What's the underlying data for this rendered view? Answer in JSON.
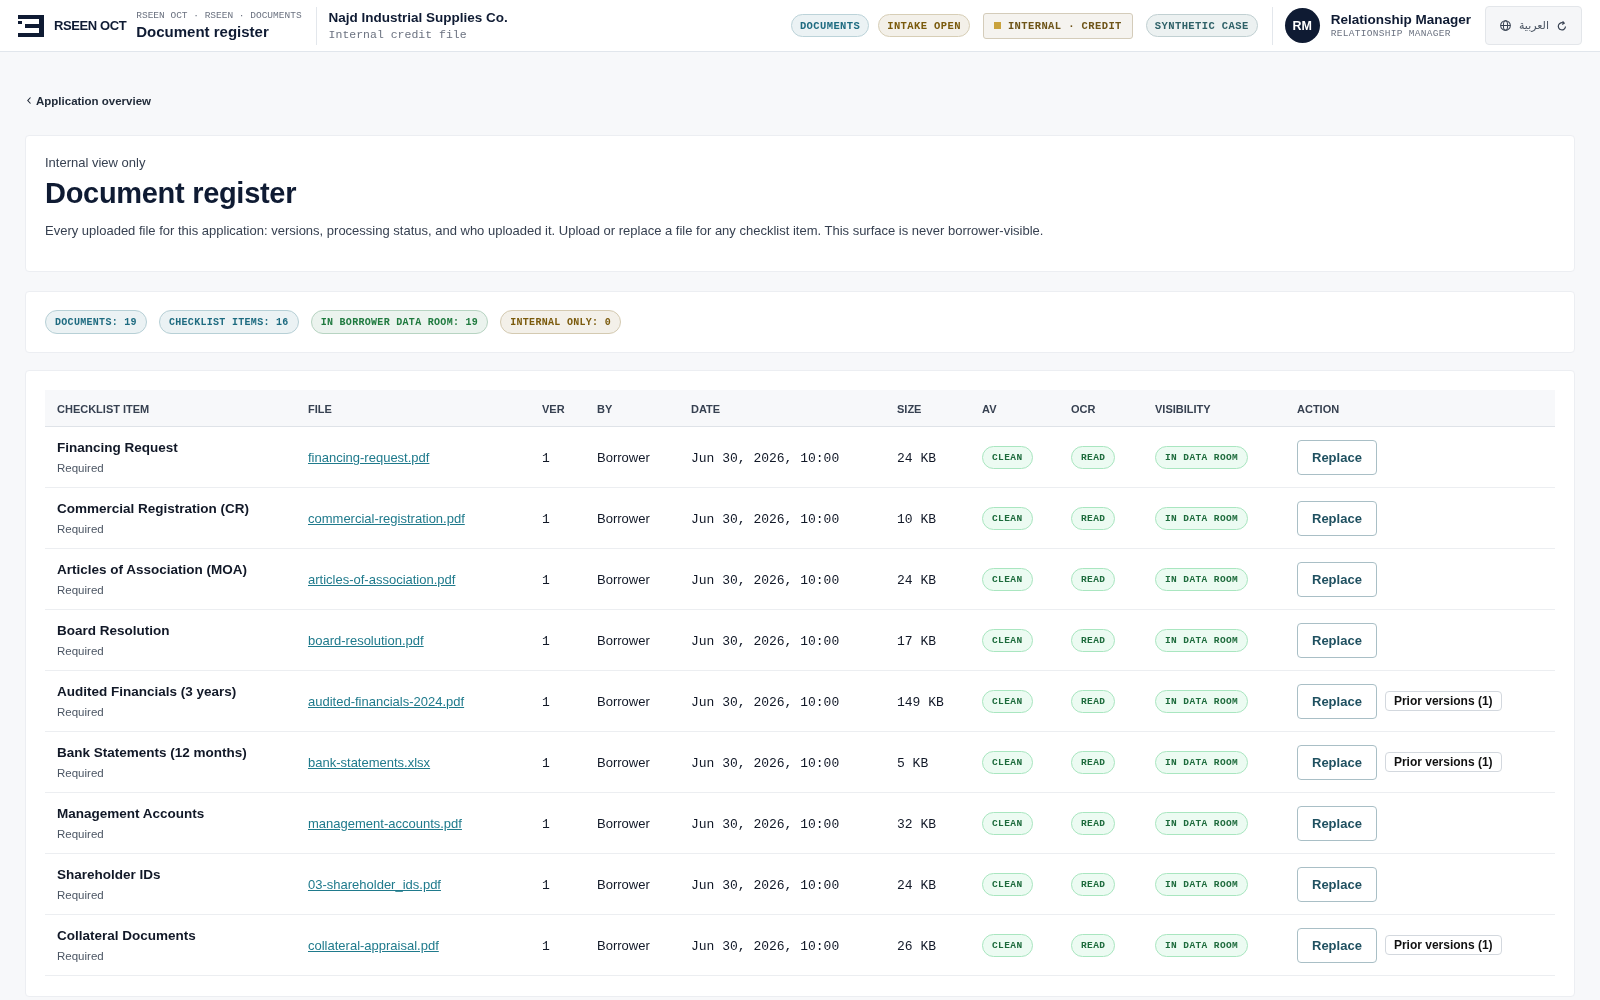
{
  "header": {
    "brand": "RSEEN OCT",
    "breadcrumb": "RSEEN OCT · RSEEN · DOCUMENTS",
    "title": "Document register",
    "company": "Najd Industrial Supplies Co.",
    "company_subtitle": "Internal credit file",
    "badges": [
      {
        "label": "DOCUMENTS",
        "kind": "pill",
        "color": "#1e6b80"
      },
      {
        "label": "INTAKE OPEN",
        "kind": "pill",
        "color": "#7a5a0c"
      },
      {
        "label": "INTERNAL · CREDIT",
        "kind": "flag",
        "color": "#6e5418"
      },
      {
        "label": "SYNTHETIC CASE",
        "kind": "pill",
        "color": "#2f6168"
      }
    ],
    "user": {
      "initials": "RM",
      "name": "Relationship Manager",
      "role": "RELATIONSHIP MANAGER"
    },
    "language_button": {
      "label": "العربية"
    }
  },
  "back_link": "Application overview",
  "intro": {
    "eyebrow": "Internal view only",
    "title": "Document register",
    "description": "Every uploaded file for this application: versions, processing status, and who uploaded it. Upload or replace a file for any checklist item. This surface is never borrower-visible."
  },
  "stats": [
    {
      "label": "DOCUMENTS: 19",
      "color": "#1e6b80"
    },
    {
      "label": "CHECKLIST ITEMS: 16",
      "color": "#1e6b80"
    },
    {
      "label": "IN BORROWER DATA ROOM: 19",
      "color": "#1f7a3f"
    },
    {
      "label": "INTERNAL ONLY: 0",
      "color": "#7a5a0c"
    }
  ],
  "table": {
    "columns": [
      "CHECKLIST ITEM",
      "FILE",
      "VER",
      "BY",
      "DATE",
      "SIZE",
      "AV",
      "OCR",
      "VISIBILITY",
      "ACTION"
    ],
    "rows": [
      {
        "item": "Financing Request",
        "requirement": "Required",
        "file": "financing-request.pdf",
        "version": "1",
        "uploaded_by": "Borrower",
        "date": "Jun 30, 2026, 10:00",
        "size": "24 KB",
        "av": "CLEAN",
        "ocr": "READ",
        "visibility": "IN DATA ROOM",
        "actions": [
          {
            "kind": "replace",
            "label": "Replace"
          }
        ]
      },
      {
        "item": "Commercial Registration (CR)",
        "requirement": "Required",
        "file": "commercial-registration.pdf",
        "version": "1",
        "uploaded_by": "Borrower",
        "date": "Jun 30, 2026, 10:00",
        "size": "10 KB",
        "av": "CLEAN",
        "ocr": "READ",
        "visibility": "IN DATA ROOM",
        "actions": [
          {
            "kind": "replace",
            "label": "Replace"
          }
        ]
      },
      {
        "item": "Articles of Association (MOA)",
        "requirement": "Required",
        "file": "articles-of-association.pdf",
        "version": "1",
        "uploaded_by": "Borrower",
        "date": "Jun 30, 2026, 10:00",
        "size": "24 KB",
        "av": "CLEAN",
        "ocr": "READ",
        "visibility": "IN DATA ROOM",
        "actions": [
          {
            "kind": "replace",
            "label": "Replace"
          }
        ]
      },
      {
        "item": "Board Resolution",
        "requirement": "Required",
        "file": "board-resolution.pdf",
        "version": "1",
        "uploaded_by": "Borrower",
        "date": "Jun 30, 2026, 10:00",
        "size": "17 KB",
        "av": "CLEAN",
        "ocr": "READ",
        "visibility": "IN DATA ROOM",
        "actions": [
          {
            "kind": "replace",
            "label": "Replace"
          }
        ]
      },
      {
        "item": "Audited Financials (3 years)",
        "requirement": "Required",
        "file": "audited-financials-2024.pdf",
        "version": "1",
        "uploaded_by": "Borrower",
        "date": "Jun 30, 2026, 10:00",
        "size": "149 KB",
        "av": "CLEAN",
        "ocr": "READ",
        "visibility": "IN DATA ROOM",
        "actions": [
          {
            "kind": "replace",
            "label": "Replace"
          },
          {
            "kind": "history",
            "label": "Prior versions (1)"
          }
        ]
      },
      {
        "item": "Bank Statements (12 months)",
        "requirement": "Required",
        "file": "bank-statements.xlsx",
        "version": "1",
        "uploaded_by": "Borrower",
        "date": "Jun 30, 2026, 10:00",
        "size": "5 KB",
        "av": "CLEAN",
        "ocr": "READ",
        "visibility": "IN DATA ROOM",
        "actions": [
          {
            "kind": "replace",
            "label": "Replace"
          },
          {
            "kind": "history",
            "label": "Prior versions (1)"
          }
        ]
      },
      {
        "item": "Management Accounts",
        "requirement": "Required",
        "file": "management-accounts.pdf",
        "version": "1",
        "uploaded_by": "Borrower",
        "date": "Jun 30, 2026, 10:00",
        "size": "32 KB",
        "av": "CLEAN",
        "ocr": "READ",
        "visibility": "IN DATA ROOM",
        "actions": [
          {
            "kind": "replace",
            "label": "Replace"
          }
        ]
      },
      {
        "item": "Shareholder IDs",
        "requirement": "Required",
        "file": "03-shareholder_ids.pdf",
        "version": "1",
        "uploaded_by": "Borrower",
        "date": "Jun 30, 2026, 10:00",
        "size": "24 KB",
        "av": "CLEAN",
        "ocr": "READ",
        "visibility": "IN DATA ROOM",
        "actions": [
          {
            "kind": "replace",
            "label": "Replace"
          }
        ]
      },
      {
        "item": "Collateral Documents",
        "requirement": "Required",
        "file": "collateral-appraisal.pdf",
        "version": "1",
        "uploaded_by": "Borrower",
        "date": "Jun 30, 2026, 10:00",
        "size": "26 KB",
        "av": "CLEAN",
        "ocr": "READ",
        "visibility": "IN DATA ROOM",
        "actions": [
          {
            "kind": "replace",
            "label": "Replace"
          },
          {
            "kind": "history",
            "label": "Prior versions (1)"
          }
        ]
      }
    ]
  }
}
